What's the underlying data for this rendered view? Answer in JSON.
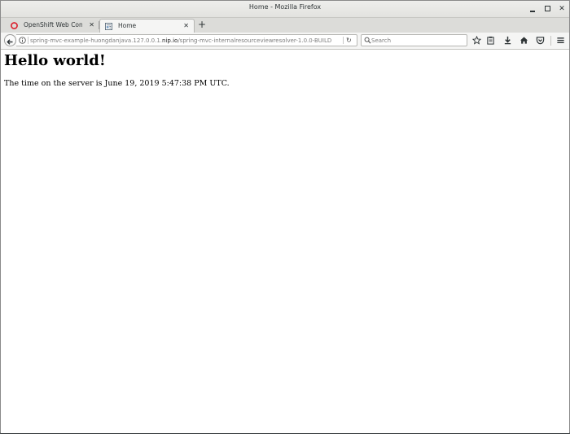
{
  "window": {
    "title": "Home - Mozilla Firefox"
  },
  "tabs": [
    {
      "label": "OpenShift Web Cons…",
      "icon": "openshift-icon",
      "active": false
    },
    {
      "label": "Home",
      "icon": "page-icon",
      "active": true
    }
  ],
  "navbar": {
    "url_prefix": "spring-mvc-example-huongdanjava.127.0.0.1.",
    "url_host": "nip.io",
    "url_suffix": "/spring-mvc-internalresourceviewresolver-1.0.0-BUILD",
    "search_placeholder": "Search"
  },
  "page": {
    "heading": "Hello world!",
    "message": "The time on the server is June 19, 2019 5:47:38 PM UTC."
  },
  "colors": {
    "openshift_red": "#db212e",
    "chrome_bg": "#f5f5f4",
    "tabstrip_bg": "#dcdcd9"
  }
}
